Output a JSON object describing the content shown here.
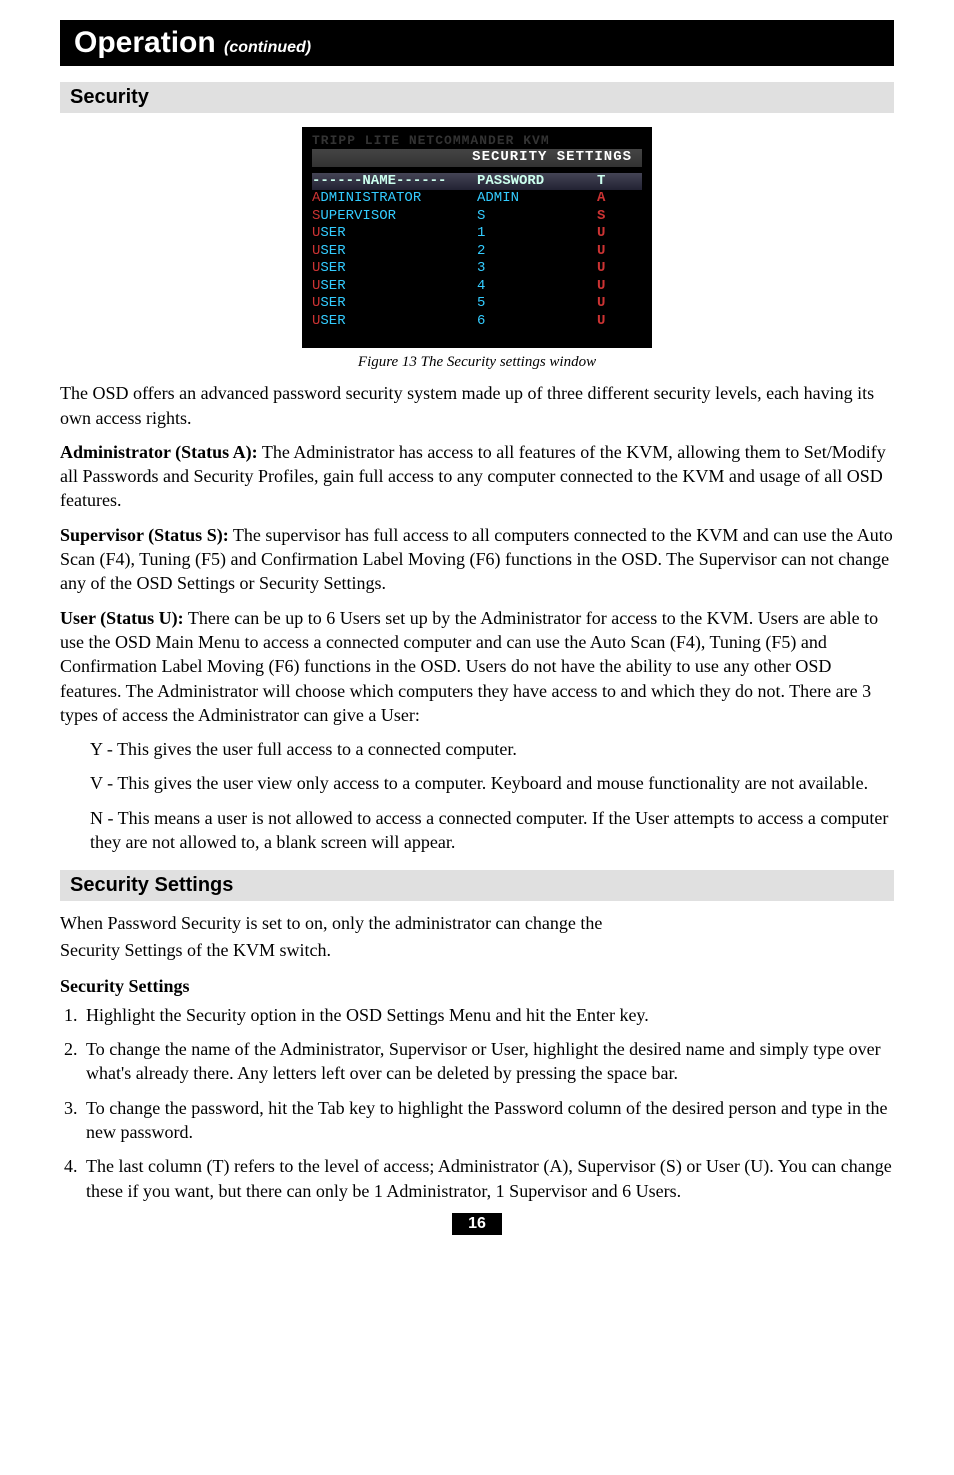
{
  "header": {
    "title": "Operation",
    "subtitle": "(continued)"
  },
  "section1": {
    "title": "Security"
  },
  "figure": {
    "ghost": "TRIPP LITE NETCOMMANDER KVM",
    "subtitle": "SECURITY SETTINGS",
    "head_name": "------NAME------",
    "head_pwd": "PASSWORD",
    "head_t": "T",
    "rows": [
      {
        "name_first": "A",
        "name_rest": "DMINISTRATOR",
        "pwd": "ADMIN",
        "t": "A"
      },
      {
        "name_first": "S",
        "name_rest": "UPERVISOR",
        "pwd": "S",
        "t": "S"
      },
      {
        "name_first": "U",
        "name_rest": "SER",
        "pwd": "1",
        "t": "U"
      },
      {
        "name_first": "U",
        "name_rest": "SER",
        "pwd": "2",
        "t": "U"
      },
      {
        "name_first": "U",
        "name_rest": "SER",
        "pwd": "3",
        "t": "U"
      },
      {
        "name_first": "U",
        "name_rest": "SER",
        "pwd": "4",
        "t": "U"
      },
      {
        "name_first": "U",
        "name_rest": "SER",
        "pwd": "5",
        "t": "U"
      },
      {
        "name_first": "U",
        "name_rest": "SER",
        "pwd": "6",
        "t": "U"
      }
    ],
    "caption": "Figure 13 The Security settings window"
  },
  "paras": {
    "intro": "The OSD offers an advanced password security system made up of three different security levels, each having its own access rights.",
    "admin_label": "Administrator (Status A):",
    "admin_text": " The Administrator has access to all features of the KVM, allowing them to Set/Modify all Passwords and Security Profiles, gain full access to any computer connected to the KVM and usage of all OSD features.",
    "sup_label": "Supervisor (Status S):",
    "sup_text": " The supervisor has full access to all computers connected to the KVM and can use the Auto Scan (F4), Tuning (F5) and Confirmation Label Moving (F6) functions in the OSD. The Supervisor can not change any of the OSD Settings or Security Settings.",
    "user_label": "User (Status U):",
    "user_text": " There can be up to 6 Users set up by the Administrator for access to the KVM. Users are able to use the OSD Main Menu to access a connected computer and can use the Auto Scan (F4), Tuning (F5) and Confirmation Label Moving (F6) functions in the OSD. Users do not have the ability to use any other OSD features. The Administrator will choose which computers they have access to and which they do not. There are 3 types of access the Administrator can give a User:",
    "y": "Y - This gives the user full access to a connected computer.",
    "v": "V - This gives the user view only access to a computer. Keyboard and mouse functionality are not available.",
    "n": "N - This means a user is not allowed to access a connected computer. If the User attempts to access a computer they are not allowed to, a blank screen will appear."
  },
  "section2": {
    "title": "Security Settings",
    "p1": "When Password Security is set to on, only the administrator can change the",
    "p2": "Security Settings of the KVM switch.",
    "subhead": "Security Settings",
    "steps": [
      "Highlight the Security option in the OSD Settings Menu and hit the Enter key.",
      "To change the name of the Administrator, Supervisor or User, highlight the desired name and simply type over what's already there. Any letters left over can be deleted by pressing the space bar.",
      "To change the password, hit the Tab key to highlight the Password column of the desired person and type in the new password.",
      "The last column (T) refers to the level of access; Administrator (A), Supervisor (S) or User (U). You can change these if you want, but there can only be 1 Administrator, 1 Supervisor and 6 Users."
    ]
  },
  "page_number": "16"
}
